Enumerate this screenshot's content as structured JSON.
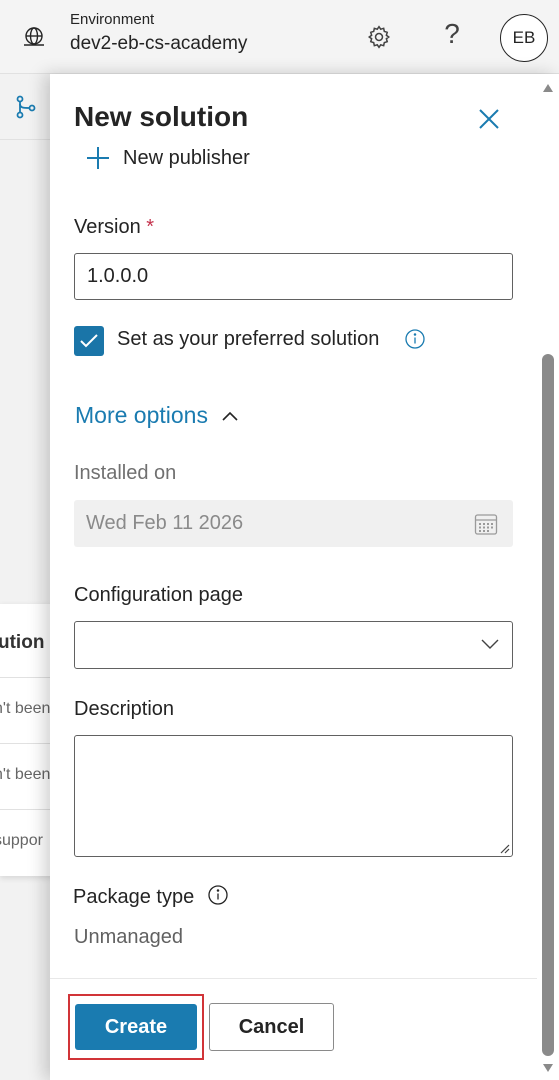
{
  "header": {
    "environment_label": "Environment",
    "environment_name": "dev2-eb-cs-academy",
    "help_glyph": "?",
    "avatar_initials": "EB",
    "icons": [
      "globe-icon",
      "gear-icon",
      "help-icon"
    ]
  },
  "background": {
    "table_header_fragment": "ution",
    "rows": [
      "n't been",
      "n't been",
      "suppor"
    ],
    "icons": [
      "branch-icon"
    ]
  },
  "panel": {
    "title": "New solution",
    "new_publisher_label": "New publisher",
    "version": {
      "label": "Version",
      "required_mark": "*",
      "value": "1.0.0.0"
    },
    "preferred": {
      "label": "Set as your preferred solution",
      "checked": true
    },
    "more_options_label": "More options",
    "installed_on": {
      "label": "Installed on",
      "value": "Wed Feb 11 2026"
    },
    "configuration_page": {
      "label": "Configuration page",
      "value": ""
    },
    "description": {
      "label": "Description",
      "value": ""
    },
    "package_type": {
      "label": "Package type",
      "value": "Unmanaged"
    },
    "buttons": {
      "create": "Create",
      "cancel": "Cancel"
    }
  },
  "colors": {
    "accent": "#1a7bb0",
    "highlight_border": "#d13438",
    "required": "#c4314b"
  }
}
